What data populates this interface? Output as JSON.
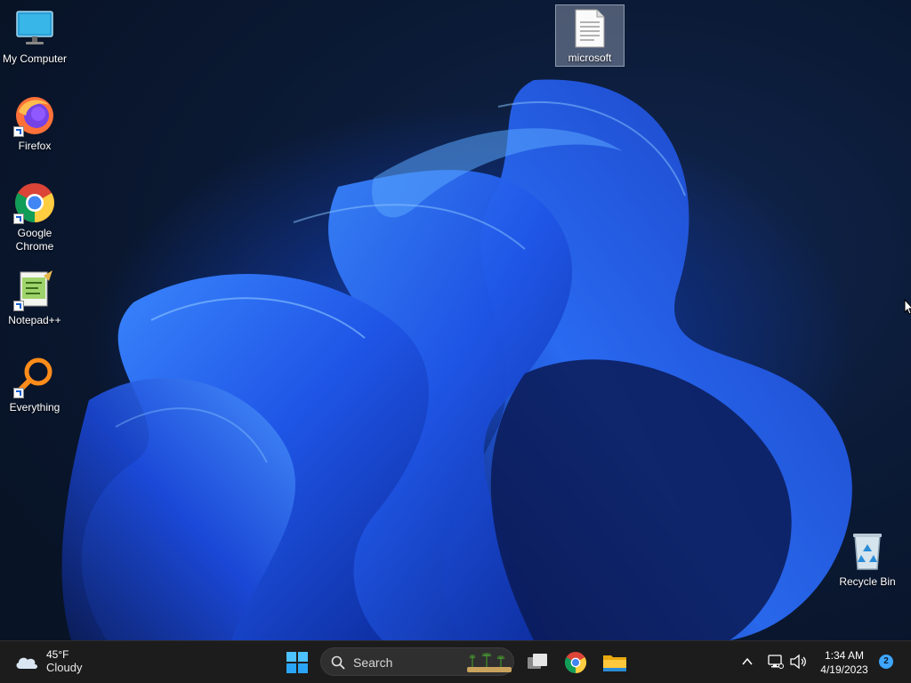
{
  "desktop": {
    "icons": [
      {
        "label": "My Computer",
        "icon": "monitor-icon"
      },
      {
        "label": "Firefox",
        "icon": "firefox-icon"
      },
      {
        "label": "Google Chrome",
        "icon": "chrome-icon"
      },
      {
        "label": "Notepad++",
        "icon": "notepadpp-icon"
      },
      {
        "label": "Everything",
        "icon": "search-magnifier-icon"
      },
      {
        "label": "microsoft",
        "icon": "document-icon"
      },
      {
        "label": "Recycle Bin",
        "icon": "recycle-bin-icon"
      }
    ]
  },
  "taskbar": {
    "weather": {
      "temp": "45°F",
      "condition": "Cloudy",
      "icon": "cloud-icon"
    },
    "search": {
      "placeholder": "Search"
    },
    "apps": [
      {
        "icon": "windows-start-icon"
      },
      {
        "icon": "task-view-icon"
      },
      {
        "icon": "chrome-icon"
      },
      {
        "icon": "file-explorer-icon"
      }
    ],
    "tray": {
      "time": "1:34 AM",
      "date": "4/19/2023",
      "notifications": "2"
    }
  },
  "colors": {
    "taskbar_bg": "#1c1c1c",
    "accent_blue": "#1b4fd0",
    "badge": "#3ea6ff"
  }
}
